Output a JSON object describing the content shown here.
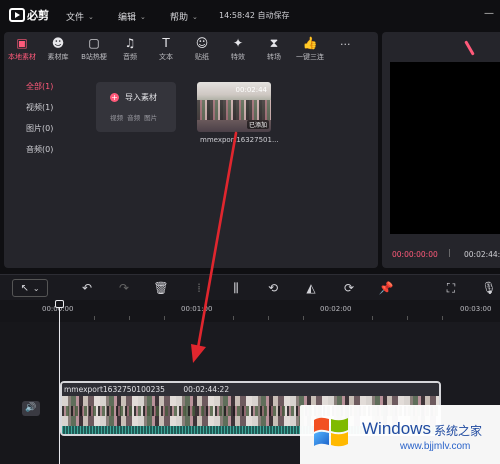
{
  "titlebar": {
    "app_name": "必剪",
    "menus": [
      {
        "label": "文件",
        "caret": "⌄"
      },
      {
        "label": "编辑",
        "caret": "⌄"
      },
      {
        "label": "帮助",
        "caret": "⌄"
      }
    ],
    "status": "14:58:42 自动保存",
    "window_control": "—"
  },
  "media_toolbar": {
    "tabs": [
      {
        "label": "本地素材",
        "icon": "folder-icon",
        "glyph": "▣",
        "active": true
      },
      {
        "label": "素材库",
        "icon": "face-icon",
        "glyph": "☻"
      },
      {
        "label": "B站热梗",
        "icon": "tv-icon",
        "glyph": "▢"
      },
      {
        "label": "音频",
        "icon": "music-icon",
        "glyph": "♫"
      },
      {
        "label": "文本",
        "icon": "text-icon",
        "glyph": "T"
      },
      {
        "label": "贴纸",
        "icon": "sticker-icon",
        "glyph": "☺"
      },
      {
        "label": "特效",
        "icon": "effects-icon",
        "glyph": "✦"
      },
      {
        "label": "转场",
        "icon": "transition-icon",
        "glyph": "⧗"
      },
      {
        "label": "一键三连",
        "icon": "thumb-up-icon",
        "glyph": "👍"
      }
    ],
    "more": "···"
  },
  "categories": [
    {
      "label": "全部(1)",
      "active": true
    },
    {
      "label": "视频(1)"
    },
    {
      "label": "图片(0)"
    },
    {
      "label": "音频(0)"
    }
  ],
  "import_card": {
    "title": "导入素材",
    "subtitle": "视频 音频 图片"
  },
  "media_item": {
    "duration": "00:02:44",
    "badge": "已添加",
    "name": "mmexport163275​01..."
  },
  "player": {
    "current_time": "00:00:00:00",
    "separator": "|",
    "total_time": "00:02:44:2"
  },
  "timeline": {
    "ruler_labels": [
      "00:00:00",
      "00:01:00",
      "00:02:00",
      "00:03:00"
    ],
    "clip": {
      "name": "mmexport1632750100235",
      "duration": "00:02:44:22"
    }
  },
  "watermark": {
    "title": "Windows",
    "cn": "系统之家",
    "url": "www.bjjmlv.com"
  },
  "colors": {
    "accent": "#ff5a7a",
    "arrow": "#e0262e",
    "panel": "#25252b"
  }
}
